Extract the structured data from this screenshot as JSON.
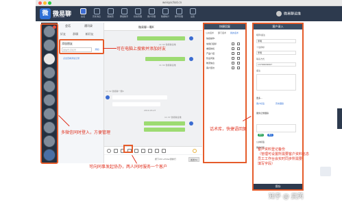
{
  "browser": {
    "url": "weisyschat.cn"
  },
  "app": {
    "logo_char": "微",
    "name": "微易聊",
    "subtitle": "WEI YI LIAO"
  },
  "nav": [
    {
      "label": "会话",
      "active": true
    },
    {
      "label": "历史消息"
    },
    {
      "label": "朋友圈"
    },
    {
      "label": "群发助手"
    },
    {
      "label": "好友管理"
    },
    {
      "label": "客户管理"
    },
    {
      "label": "数据统计"
    },
    {
      "label": "账号管理"
    },
    {
      "label": "设置"
    }
  ],
  "user": {
    "name": "微易聊运维"
  },
  "contacts": {
    "tabs": [
      "会话",
      "通讯录"
    ],
    "subtabs": [
      "好友",
      "群聊",
      "新好友"
    ],
    "add_friend": {
      "title": "添加朋友",
      "placeholder": "微信号/手机号",
      "button": "添加"
    },
    "tip": "点击查看添加记录"
  },
  "chat": {
    "title": "微易聊一颗K",
    "messages": [
      {
        "side": "right",
        "meta": "11:32 微易聊运维"
      },
      {
        "side": "right",
        "meta": "11:32 微易聊运维"
      },
      {
        "side": "left",
        "meta": "11:32 微易聊一颗K"
      },
      {
        "side": "left",
        "meta": "2019-03-27"
      },
      {
        "side": "right",
        "meta": "11:37 微易聊运维"
      }
    ],
    "send_hint": "按下Ctrl+Enter键换行",
    "send_button": "发送(S)"
  },
  "quick_reply": {
    "title": "快捷回复",
    "tabs": [
      "公共话术",
      "部门话术",
      "我的话术"
    ],
    "label": "快捷操作:",
    "items": [
      "常用打招呼",
      "重装新机",
      "产品介绍",
      "售后问答",
      "物流信息",
      "客户回访"
    ]
  },
  "customer": {
    "title": "客户录入",
    "fields": [
      {
        "label": "昵称/备注",
        "value": ""
      },
      {
        "label": "",
        "value": "李明"
      },
      {
        "label": "个性称呼",
        "value": "李明"
      },
      {
        "label": "联系方式",
        "value": "13700009997"
      },
      {
        "label": "备注",
        "value": ""
      }
    ],
    "more": "更多...",
    "links": [
      "客户标签",
      "历史跟踪"
    ],
    "service_record": "服务记录跟踪",
    "tags": [
      {
        "text": "意向",
        "color": "#2aa35a"
      },
      {
        "text": "重点",
        "color": "#2f6fd6"
      }
    ],
    "groups": [
      "公共标签",
      "我的标签"
    ],
    "save": "保存"
  },
  "annotations": {
    "add_friend": "可在电脑上搜索并添加好友",
    "multi_login": "多微信同时登入，方便管理",
    "collab": "可向同事发起协办，两人同时服务一个客户",
    "quick_reply": "话术库，快捷语回复",
    "customer": "客户资料登记备份\n（管理可设置所需要客户资料信息\n员工工作台会实时同步所需要\n填写字段）"
  },
  "watermark": "知乎 @ 武芮"
}
